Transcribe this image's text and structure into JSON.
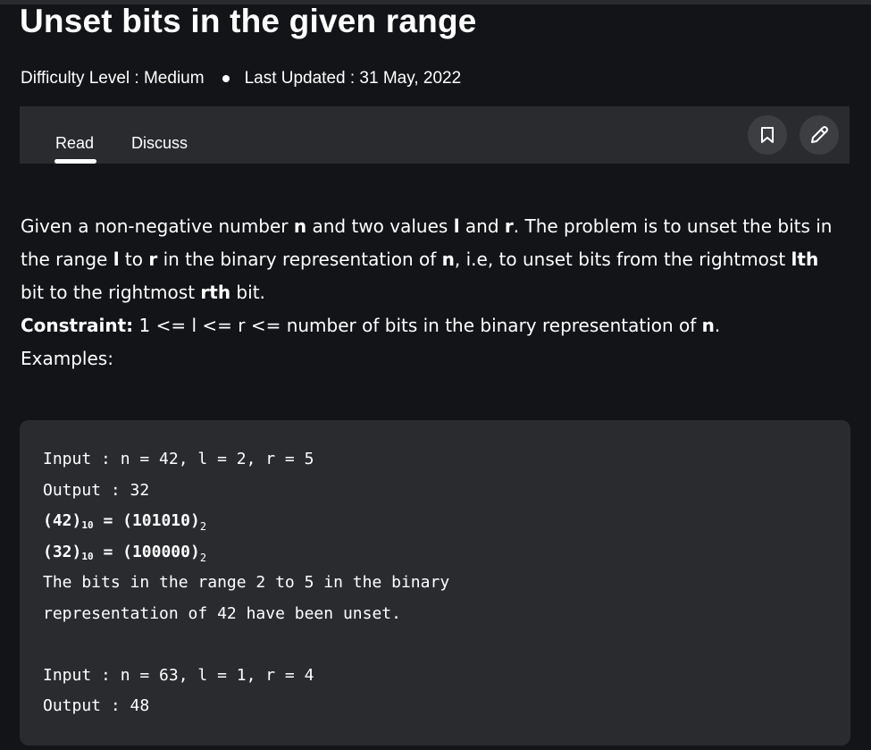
{
  "article": {
    "title": "Unset bits in the given range",
    "difficulty": "Difficulty Level : Medium",
    "updated": "Last Updated : 31 May, 2022"
  },
  "tabs": [
    {
      "label": "Read",
      "active": true
    },
    {
      "label": "Discuss",
      "active": false
    }
  ],
  "actions": {
    "bookmark_icon": "bookmark-icon",
    "edit_icon": "pencil-icon"
  },
  "body": {
    "p1_a": "Given a non-negative number ",
    "p1_n": "n",
    "p1_b": " and two values ",
    "p1_l": "l",
    "p1_c": " and ",
    "p1_r": "r",
    "p1_d": ". The problem is to unset the bits in the range ",
    "p1_l2": "l",
    "p1_e": " to ",
    "p1_r2": "r",
    "p1_f": " in the binary representation of ",
    "p1_n2": "n",
    "p1_g": ", i.e, to unset bits from the rightmost ",
    "p1_lth": "lth",
    "p1_h": " bit to the rightmost ",
    "p1_rth": "rth",
    "p1_i": " bit.",
    "constraint_label": "Constraint:",
    "constraint_text": " 1 <= l <= r <= number of bits in the binary representation of ",
    "constraint_n": "n",
    "constraint_end": ".",
    "examples": "Examples:"
  },
  "code": {
    "line1": "Input : n = 42, l = 2, r = 5",
    "line2": "Output : 32",
    "line3_a": "(42)",
    "line3_sub": "10",
    "line3_b": " = (101010)",
    "line3_sub2": "2",
    "line4_a": "(32)",
    "line4_sub": "10",
    "line4_b": " = (100000)",
    "line4_sub2": "2",
    "line5": "The bits in the range 2 to 5 in the binary",
    "line6": "representation of 42 have been unset.",
    "line7": "",
    "line8": "Input : n = 63, l = 1, r = 4",
    "line9": "Output : 48"
  },
  "colors": {
    "background": "#131417",
    "panel": "#2a2b2f",
    "icon_button": "#3d3e42",
    "text": "#ffffff"
  }
}
